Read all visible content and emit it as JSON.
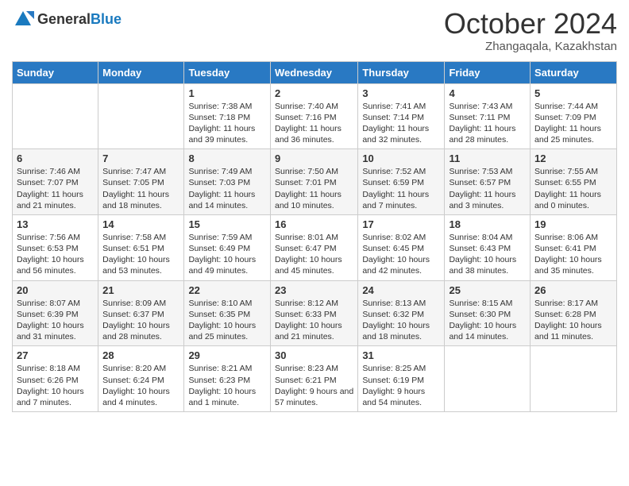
{
  "header": {
    "logo_general": "General",
    "logo_blue": "Blue",
    "title": "October 2024",
    "subtitle": "Zhangaqala, Kazakhstan"
  },
  "calendar": {
    "columns": [
      "Sunday",
      "Monday",
      "Tuesday",
      "Wednesday",
      "Thursday",
      "Friday",
      "Saturday"
    ],
    "weeks": [
      [
        {
          "day": "",
          "info": ""
        },
        {
          "day": "",
          "info": ""
        },
        {
          "day": "1",
          "info": "Sunrise: 7:38 AM\nSunset: 7:18 PM\nDaylight: 11 hours and 39 minutes."
        },
        {
          "day": "2",
          "info": "Sunrise: 7:40 AM\nSunset: 7:16 PM\nDaylight: 11 hours and 36 minutes."
        },
        {
          "day": "3",
          "info": "Sunrise: 7:41 AM\nSunset: 7:14 PM\nDaylight: 11 hours and 32 minutes."
        },
        {
          "day": "4",
          "info": "Sunrise: 7:43 AM\nSunset: 7:11 PM\nDaylight: 11 hours and 28 minutes."
        },
        {
          "day": "5",
          "info": "Sunrise: 7:44 AM\nSunset: 7:09 PM\nDaylight: 11 hours and 25 minutes."
        }
      ],
      [
        {
          "day": "6",
          "info": "Sunrise: 7:46 AM\nSunset: 7:07 PM\nDaylight: 11 hours and 21 minutes."
        },
        {
          "day": "7",
          "info": "Sunrise: 7:47 AM\nSunset: 7:05 PM\nDaylight: 11 hours and 18 minutes."
        },
        {
          "day": "8",
          "info": "Sunrise: 7:49 AM\nSunset: 7:03 PM\nDaylight: 11 hours and 14 minutes."
        },
        {
          "day": "9",
          "info": "Sunrise: 7:50 AM\nSunset: 7:01 PM\nDaylight: 11 hours and 10 minutes."
        },
        {
          "day": "10",
          "info": "Sunrise: 7:52 AM\nSunset: 6:59 PM\nDaylight: 11 hours and 7 minutes."
        },
        {
          "day": "11",
          "info": "Sunrise: 7:53 AM\nSunset: 6:57 PM\nDaylight: 11 hours and 3 minutes."
        },
        {
          "day": "12",
          "info": "Sunrise: 7:55 AM\nSunset: 6:55 PM\nDaylight: 11 hours and 0 minutes."
        }
      ],
      [
        {
          "day": "13",
          "info": "Sunrise: 7:56 AM\nSunset: 6:53 PM\nDaylight: 10 hours and 56 minutes."
        },
        {
          "day": "14",
          "info": "Sunrise: 7:58 AM\nSunset: 6:51 PM\nDaylight: 10 hours and 53 minutes."
        },
        {
          "day": "15",
          "info": "Sunrise: 7:59 AM\nSunset: 6:49 PM\nDaylight: 10 hours and 49 minutes."
        },
        {
          "day": "16",
          "info": "Sunrise: 8:01 AM\nSunset: 6:47 PM\nDaylight: 10 hours and 45 minutes."
        },
        {
          "day": "17",
          "info": "Sunrise: 8:02 AM\nSunset: 6:45 PM\nDaylight: 10 hours and 42 minutes."
        },
        {
          "day": "18",
          "info": "Sunrise: 8:04 AM\nSunset: 6:43 PM\nDaylight: 10 hours and 38 minutes."
        },
        {
          "day": "19",
          "info": "Sunrise: 8:06 AM\nSunset: 6:41 PM\nDaylight: 10 hours and 35 minutes."
        }
      ],
      [
        {
          "day": "20",
          "info": "Sunrise: 8:07 AM\nSunset: 6:39 PM\nDaylight: 10 hours and 31 minutes."
        },
        {
          "day": "21",
          "info": "Sunrise: 8:09 AM\nSunset: 6:37 PM\nDaylight: 10 hours and 28 minutes."
        },
        {
          "day": "22",
          "info": "Sunrise: 8:10 AM\nSunset: 6:35 PM\nDaylight: 10 hours and 25 minutes."
        },
        {
          "day": "23",
          "info": "Sunrise: 8:12 AM\nSunset: 6:33 PM\nDaylight: 10 hours and 21 minutes."
        },
        {
          "day": "24",
          "info": "Sunrise: 8:13 AM\nSunset: 6:32 PM\nDaylight: 10 hours and 18 minutes."
        },
        {
          "day": "25",
          "info": "Sunrise: 8:15 AM\nSunset: 6:30 PM\nDaylight: 10 hours and 14 minutes."
        },
        {
          "day": "26",
          "info": "Sunrise: 8:17 AM\nSunset: 6:28 PM\nDaylight: 10 hours and 11 minutes."
        }
      ],
      [
        {
          "day": "27",
          "info": "Sunrise: 8:18 AM\nSunset: 6:26 PM\nDaylight: 10 hours and 7 minutes."
        },
        {
          "day": "28",
          "info": "Sunrise: 8:20 AM\nSunset: 6:24 PM\nDaylight: 10 hours and 4 minutes."
        },
        {
          "day": "29",
          "info": "Sunrise: 8:21 AM\nSunset: 6:23 PM\nDaylight: 10 hours and 1 minute."
        },
        {
          "day": "30",
          "info": "Sunrise: 8:23 AM\nSunset: 6:21 PM\nDaylight: 9 hours and 57 minutes."
        },
        {
          "day": "31",
          "info": "Sunrise: 8:25 AM\nSunset: 6:19 PM\nDaylight: 9 hours and 54 minutes."
        },
        {
          "day": "",
          "info": ""
        },
        {
          "day": "",
          "info": ""
        }
      ]
    ]
  }
}
